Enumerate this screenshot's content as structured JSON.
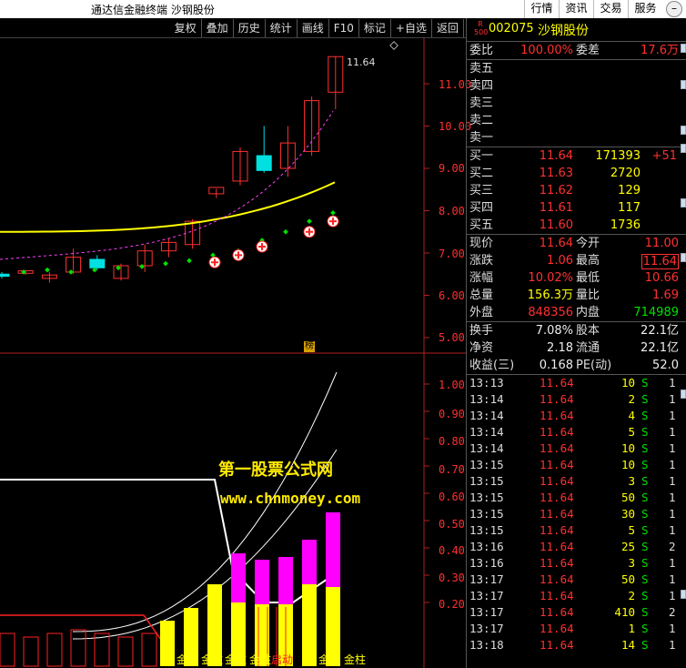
{
  "app": {
    "title": "通达信金融终端 沙钢股份"
  },
  "top_menu": [
    "行情",
    "资讯",
    "交易",
    "服务"
  ],
  "toolbar": [
    "复权",
    "叠加",
    "历史",
    "统计",
    "画线",
    "F10",
    "标记",
    "+自选",
    "返回"
  ],
  "chart": {
    "price_axis": [
      "11.00",
      "10.00",
      "9.00",
      "8.00",
      "7.00",
      "6.00",
      "5.00"
    ],
    "indicator_axis": [
      "1.00",
      "0.90",
      "0.80",
      "0.70",
      "0.60",
      "0.50",
      "0.40",
      "0.30",
      "0.20"
    ],
    "top_price_label": "11.64",
    "bang_label": "榜",
    "watermark_line1": "第一股票公式网",
    "watermark_line2": "www.chnmoney.com",
    "bar_labels": [
      {
        "text": "金柱",
        "red": false
      },
      {
        "text": "金柱",
        "red": false
      },
      {
        "text": "金柱",
        "red": false
      },
      {
        "text": "金柱",
        "red": false
      },
      {
        "text": "启动",
        "red": true
      },
      {
        "text": "金柱",
        "red": false
      },
      {
        "text": "金柱",
        "red": false
      }
    ],
    "candles": [
      {
        "o": 6.5,
        "h": 6.55,
        "l": 6.4,
        "c": 6.45
      },
      {
        "o": 6.52,
        "h": 6.6,
        "l": 6.48,
        "c": 6.58
      },
      {
        "o": 6.4,
        "h": 6.55,
        "l": 6.3,
        "c": 6.48
      },
      {
        "o": 6.55,
        "h": 7.1,
        "l": 6.5,
        "c": 6.9
      },
      {
        "o": 6.85,
        "h": 6.95,
        "l": 6.6,
        "c": 6.65
      },
      {
        "o": 6.4,
        "h": 6.75,
        "l": 6.35,
        "c": 6.7
      },
      {
        "o": 6.7,
        "h": 7.2,
        "l": 6.55,
        "c": 7.05
      },
      {
        "o": 7.05,
        "h": 7.35,
        "l": 6.9,
        "c": 7.25
      },
      {
        "o": 7.2,
        "h": 7.8,
        "l": 7.1,
        "c": 7.75
      },
      {
        "o": 8.4,
        "h": 8.52,
        "l": 8.3,
        "c": 8.55
      },
      {
        "o": 8.7,
        "h": 9.5,
        "l": 8.6,
        "c": 9.4
      },
      {
        "o": 9.3,
        "h": 10.0,
        "l": 8.9,
        "c": 8.95
      },
      {
        "o": 9.0,
        "h": 10.0,
        "l": 8.8,
        "c": 9.6
      },
      {
        "o": 9.4,
        "h": 10.7,
        "l": 9.3,
        "c": 10.6
      },
      {
        "o": 10.8,
        "h": 11.64,
        "l": 10.4,
        "c": 11.64
      }
    ]
  },
  "quote": {
    "badge_top": "R",
    "badge_bottom": "500",
    "code": "002075",
    "name": "沙钢股份",
    "weibi_label": "委比",
    "weibi_value": "100.00%",
    "weicha_label": "委差",
    "weicha_value": "17.6万",
    "sell": [
      {
        "label": "卖五"
      },
      {
        "label": "卖四"
      },
      {
        "label": "卖三"
      },
      {
        "label": "卖二"
      },
      {
        "label": "卖一"
      }
    ],
    "buy": [
      {
        "label": "买一",
        "price": "11.64",
        "vol": "171393",
        "chg": "+51"
      },
      {
        "label": "买二",
        "price": "11.63",
        "vol": "2720",
        "chg": ""
      },
      {
        "label": "买三",
        "price": "11.62",
        "vol": "129",
        "chg": ""
      },
      {
        "label": "买四",
        "price": "11.61",
        "vol": "117",
        "chg": ""
      },
      {
        "label": "买五",
        "price": "11.60",
        "vol": "1736",
        "chg": ""
      }
    ],
    "stats": [
      {
        "l1": "现价",
        "v1": "11.64",
        "c1": "red",
        "l2": "今开",
        "v2": "11.00",
        "c2": "red",
        "box": false
      },
      {
        "l1": "涨跌",
        "v1": "1.06",
        "c1": "red",
        "l2": "最高",
        "v2": "11.64",
        "c2": "red",
        "box": true
      },
      {
        "l1": "涨幅",
        "v1": "10.02%",
        "c1": "red",
        "l2": "最低",
        "v2": "10.66",
        "c2": "red",
        "box": false
      },
      {
        "l1": "总量",
        "v1": "156.3万",
        "c1": "yellow",
        "l2": "量比",
        "v2": "1.69",
        "c2": "red",
        "box": false
      },
      {
        "l1": "外盘",
        "v1": "848356",
        "c1": "red",
        "l2": "内盘",
        "v2": "714989",
        "c2": "green",
        "box": false
      }
    ],
    "fund": [
      {
        "l1": "换手",
        "v1": "7.08%",
        "l2": "股本",
        "v2": "22.1亿"
      },
      {
        "l1": "净资",
        "v1": "2.18",
        "l2": "流通",
        "v2": "22.1亿"
      },
      {
        "l1": "收益(三)",
        "v1": "0.168",
        "l2": "PE(动)",
        "v2": "52.0"
      }
    ],
    "ticks": [
      {
        "t": "13:13",
        "p": "11.64",
        "v": "10",
        "s": "S",
        "n": "1"
      },
      {
        "t": "13:14",
        "p": "11.64",
        "v": "2",
        "s": "S",
        "n": "1"
      },
      {
        "t": "13:14",
        "p": "11.64",
        "v": "4",
        "s": "S",
        "n": "1"
      },
      {
        "t": "13:14",
        "p": "11.64",
        "v": "5",
        "s": "S",
        "n": "1"
      },
      {
        "t": "13:14",
        "p": "11.64",
        "v": "10",
        "s": "S",
        "n": "1"
      },
      {
        "t": "13:15",
        "p": "11.64",
        "v": "10",
        "s": "S",
        "n": "1"
      },
      {
        "t": "13:15",
        "p": "11.64",
        "v": "3",
        "s": "S",
        "n": "1"
      },
      {
        "t": "13:15",
        "p": "11.64",
        "v": "50",
        "s": "S",
        "n": "1"
      },
      {
        "t": "13:15",
        "p": "11.64",
        "v": "30",
        "s": "S",
        "n": "1"
      },
      {
        "t": "13:15",
        "p": "11.64",
        "v": "5",
        "s": "S",
        "n": "1"
      },
      {
        "t": "13:16",
        "p": "11.64",
        "v": "25",
        "s": "S",
        "n": "2"
      },
      {
        "t": "13:16",
        "p": "11.64",
        "v": "3",
        "s": "S",
        "n": "1"
      },
      {
        "t": "13:17",
        "p": "11.64",
        "v": "50",
        "s": "S",
        "n": "1"
      },
      {
        "t": "13:17",
        "p": "11.64",
        "v": "2",
        "s": "S",
        "n": "1"
      },
      {
        "t": "13:17",
        "p": "11.64",
        "v": "410",
        "s": "S",
        "n": "2"
      },
      {
        "t": "13:17",
        "p": "11.64",
        "v": "1",
        "s": "S",
        "n": "1"
      },
      {
        "t": "13:18",
        "p": "11.64",
        "v": "14",
        "s": "S",
        "n": "1"
      }
    ]
  },
  "colors": {
    "up": "#ff3030",
    "down": "#00e0e0",
    "ma_yellow": "#ffff00",
    "ma_magenta": "#ff40ff",
    "bar_yellow": "#ffff00",
    "bar_magenta": "#ff00ff"
  }
}
